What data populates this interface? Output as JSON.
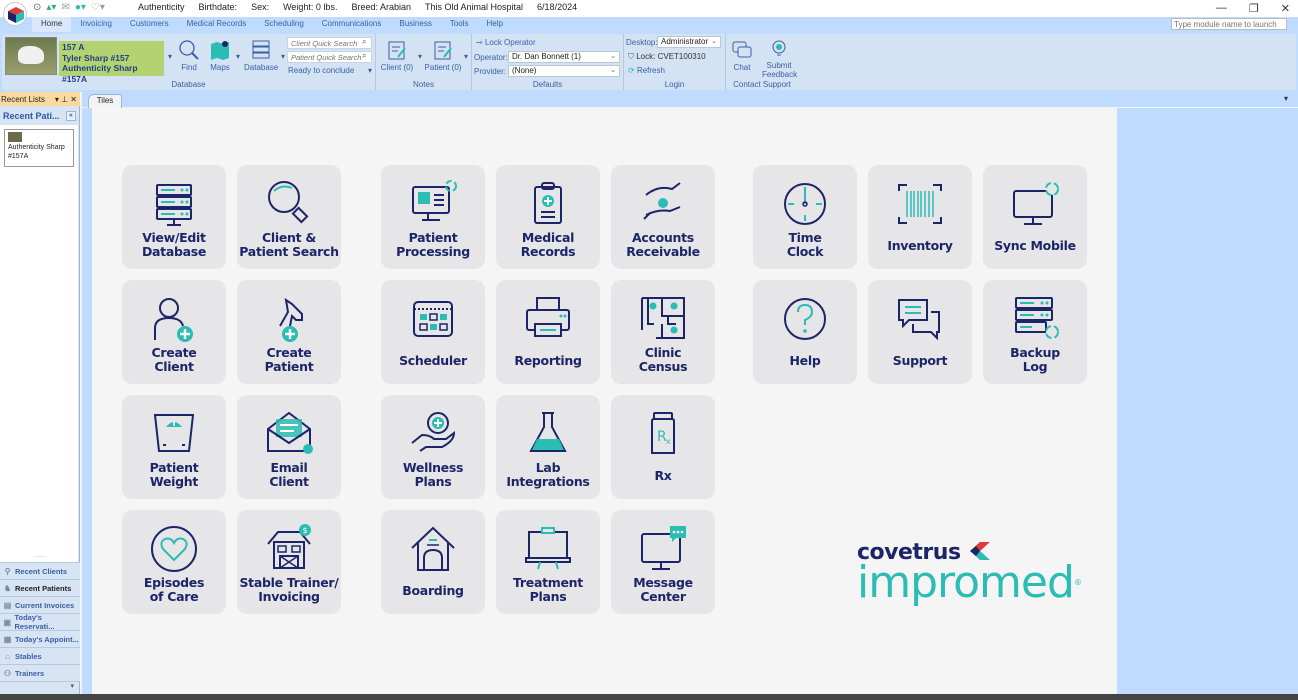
{
  "titlebar": {
    "patient_name": "Authenticity",
    "birthdate": "Birthdate:",
    "sex": "Sex:",
    "weight": "Weight: 0 lbs.",
    "breed": "Breed: Arabian",
    "hospital": "This Old Animal Hospital",
    "date": "6/18/2024",
    "launch_placeholder": "Type module name to launch",
    "minimize": "—",
    "restore": "❐",
    "close": "✕"
  },
  "menu": [
    "Home",
    "Invoicing",
    "Customers",
    "Medical Records",
    "Scheduling",
    "Communications",
    "Business",
    "Tools",
    "Help"
  ],
  "ribbon": {
    "patient": {
      "line1": "157    A",
      "line2": "Tyler Sharp #157",
      "line3": "Authenticity Sharp #157A"
    },
    "find": "Find",
    "maps": "Maps",
    "database": "Database",
    "client_search_placeholder": "Client Quick Search",
    "patient_search_placeholder": "Patient Quick Search",
    "status": "Ready to conclude",
    "database_group": "Database",
    "notes_client": "Client (0)",
    "notes_patient": "Patient (0)",
    "notes_group": "Notes",
    "lock_operator": "Lock Operator",
    "operator_label": "Operator:",
    "operator_value": "Dr. Dan Bonnett (1)",
    "provider_label": "Provider:",
    "provider_value": "(None)",
    "defaults_group": "Defaults",
    "desktop_label": "Desktop:",
    "desktop_value": "Administrator",
    "lock_id": "Lock: CVET100310",
    "refresh": "Refresh",
    "login_group": "Login",
    "chat": "Chat",
    "submit": "Submit",
    "feedback": "Feedback",
    "support_group": "Contact Support"
  },
  "tabs": {
    "active": "Tiles"
  },
  "sidebar": {
    "header": "Recent Lists",
    "header_controls": "▾  ⊥  ✕",
    "subheader": "Recent Pati...",
    "collapse": "«",
    "card_line1": "Authenticity Sharp",
    "card_line2": "#157A",
    "grip": "·····",
    "items": [
      {
        "label": "Recent Clients",
        "icon": "person-icon"
      },
      {
        "label": "Recent Patients",
        "icon": "horse-icon"
      },
      {
        "label": "Current Invoices",
        "icon": "invoice-icon"
      },
      {
        "label": "Today's Reservati...",
        "icon": "reservation-icon"
      },
      {
        "label": "Today's Appoint...",
        "icon": "appointment-icon"
      },
      {
        "label": "Stables",
        "icon": "stable-icon"
      },
      {
        "label": "Trainers",
        "icon": "trainer-icon"
      }
    ],
    "more": "▾"
  },
  "tiles": [
    {
      "label1": "View/Edit",
      "label2": "Database",
      "icon": "database-icon"
    },
    {
      "label1": "Client &",
      "label2": "Patient Search",
      "icon": "search-icon"
    },
    {
      "label1": "Patient",
      "label2": "Processing",
      "icon": "patient-processing-icon"
    },
    {
      "label1": "Medical",
      "label2": "Records",
      "icon": "clipboard-icon"
    },
    {
      "label1": "Accounts",
      "label2": "Receivable",
      "icon": "money-hands-icon"
    },
    {
      "label1": "Time",
      "label2": "Clock",
      "icon": "clock-icon"
    },
    {
      "label1": "Inventory",
      "label2": "",
      "icon": "barcode-icon"
    },
    {
      "label1": "Sync Mobile",
      "label2": "",
      "icon": "sync-monitor-icon"
    },
    {
      "label1": "Create",
      "label2": "Client",
      "icon": "add-person-icon"
    },
    {
      "label1": "Create",
      "label2": "Patient",
      "icon": "add-horse-icon"
    },
    {
      "label1": "Scheduler",
      "label2": "",
      "icon": "calendar-icon"
    },
    {
      "label1": "Reporting",
      "label2": "",
      "icon": "printer-icon"
    },
    {
      "label1": "Clinic",
      "label2": "Census",
      "icon": "floorplan-icon"
    },
    {
      "label1": "Help",
      "label2": "",
      "icon": "help-icon"
    },
    {
      "label1": "Support",
      "label2": "",
      "icon": "chat-bubbles-icon"
    },
    {
      "label1": "Backup",
      "label2": "Log",
      "icon": "backup-server-icon"
    },
    {
      "label1": "Patient",
      "label2": "Weight",
      "icon": "scale-icon"
    },
    {
      "label1": "Email",
      "label2": "Client",
      "icon": "email-icon"
    },
    {
      "label1": "Wellness",
      "label2": "Plans",
      "icon": "wellness-hand-icon"
    },
    {
      "label1": "Lab",
      "label2": "Integrations",
      "icon": "flask-icon"
    },
    {
      "label1": "Rx",
      "label2": "",
      "icon": "rx-bottle-icon"
    },
    {
      "label1": "Episodes",
      "label2": "of Care",
      "icon": "heart-icon"
    },
    {
      "label1": "Stable Trainer/",
      "label2": "Invoicing",
      "icon": "barn-icon"
    },
    {
      "label1": "Boarding",
      "label2": "",
      "icon": "house-icon"
    },
    {
      "label1": "Treatment",
      "label2": "Plans",
      "icon": "whiteboard-icon"
    },
    {
      "label1": "Message",
      "label2": "Center",
      "icon": "message-monitor-icon"
    }
  ],
  "brand": {
    "company": "covetrus",
    "product": "impromed",
    "reg": "®"
  },
  "colors": {
    "navy": "#1c2567",
    "teal": "#2bbcb4",
    "ribbon": "#bfdbff",
    "patient_box": "#b2d36f"
  }
}
